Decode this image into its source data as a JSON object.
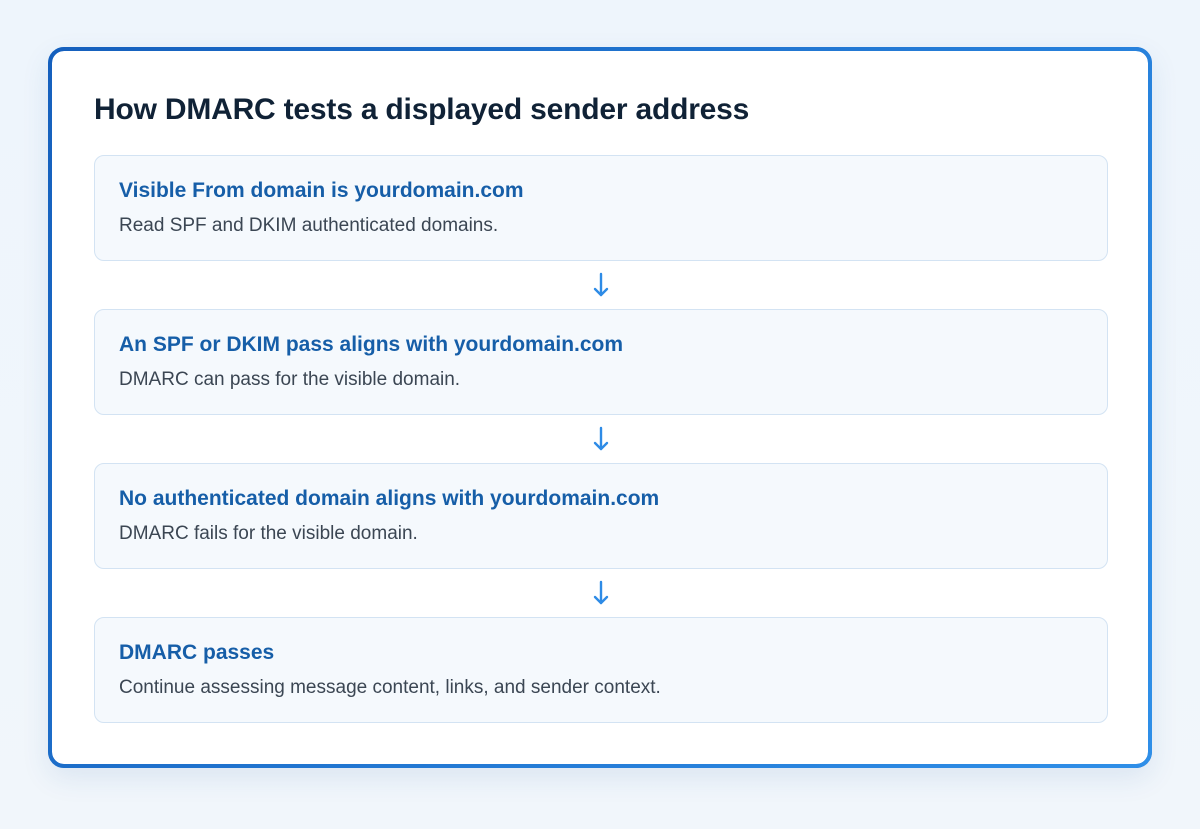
{
  "title": "How DMARC tests a displayed sender address",
  "colors": {
    "frame_border": "#1f73d6",
    "step_heading": "#165ea8",
    "step_background": "#f5f9fd",
    "arrow": "#2e8be6"
  },
  "steps": [
    {
      "heading": "Visible From domain is yourdomain.com",
      "body": "Read SPF and DKIM authenticated domains."
    },
    {
      "heading": "An SPF or DKIM pass aligns with yourdomain.com",
      "body": "DMARC can pass for the visible domain."
    },
    {
      "heading": "No authenticated domain aligns with yourdomain.com",
      "body": "DMARC fails for the visible domain."
    },
    {
      "heading": "DMARC passes",
      "body": "Continue assessing message content, links, and sender context."
    }
  ],
  "connector_icon": "arrow-down-icon"
}
